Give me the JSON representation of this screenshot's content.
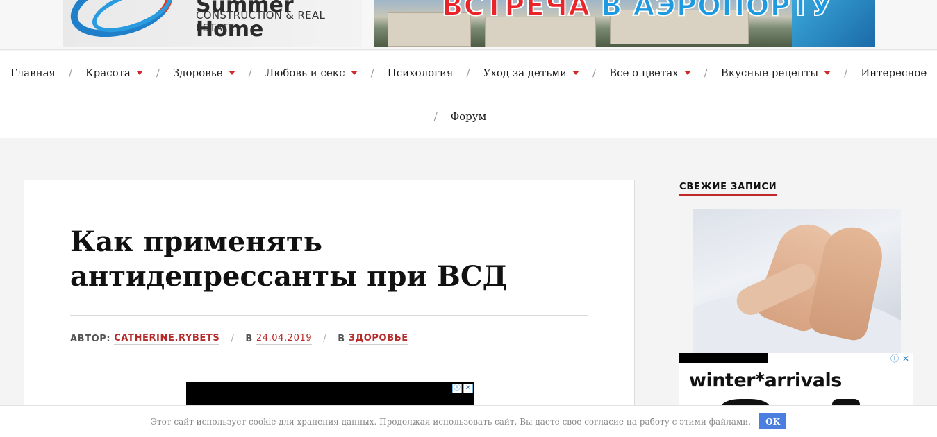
{
  "banners": {
    "left": {
      "brand": "Summer Home",
      "subtitle": "CONSTRUCTION & REAL ESTATE"
    },
    "right": {
      "slogan_word1": "ВСТРЕЧА",
      "slogan_word2": "В АЭРОПОРТУ"
    }
  },
  "nav": {
    "separator": "/",
    "items": [
      {
        "label": "Главная",
        "dropdown": false
      },
      {
        "label": "Красота",
        "dropdown": true
      },
      {
        "label": "Здоровье",
        "dropdown": true
      },
      {
        "label": "Любовь и секс",
        "dropdown": true
      },
      {
        "label": "Психология",
        "dropdown": false
      },
      {
        "label": "Уход за детьми",
        "dropdown": true
      },
      {
        "label": "Все о цветах",
        "dropdown": true
      },
      {
        "label": "Вкусные рецепты",
        "dropdown": true
      },
      {
        "label": "Интересное",
        "dropdown": false
      },
      {
        "label": "Форум",
        "dropdown": false
      }
    ]
  },
  "article": {
    "title": "Как применять антидепрессанты при ВСД",
    "meta": {
      "author_label": "АВТОР:",
      "author": "CATHERINE.RYBETS",
      "date_label": "В",
      "date": "24.04.2019",
      "category_label": "В",
      "category": "ЗДОРОВЬЕ"
    }
  },
  "sidebar": {
    "heading": "СВЕЖИЕ ЗАПИСИ",
    "ad_text": "winter*arrivals"
  },
  "ad_choices": {
    "info_glyph": "ⓘ",
    "close_glyph": "✕"
  },
  "cookie": {
    "text": "Этот сайт использует cookie для хранения данных. Продолжая использовать сайт, Вы даете свое согласие на работу с этими файлами.",
    "button": "OK"
  },
  "colors": {
    "accent_red": "#b72a2a",
    "cookie_button": "#4a7fe0",
    "banner_red": "#e9252b",
    "banner_blue": "#1e9be0"
  }
}
